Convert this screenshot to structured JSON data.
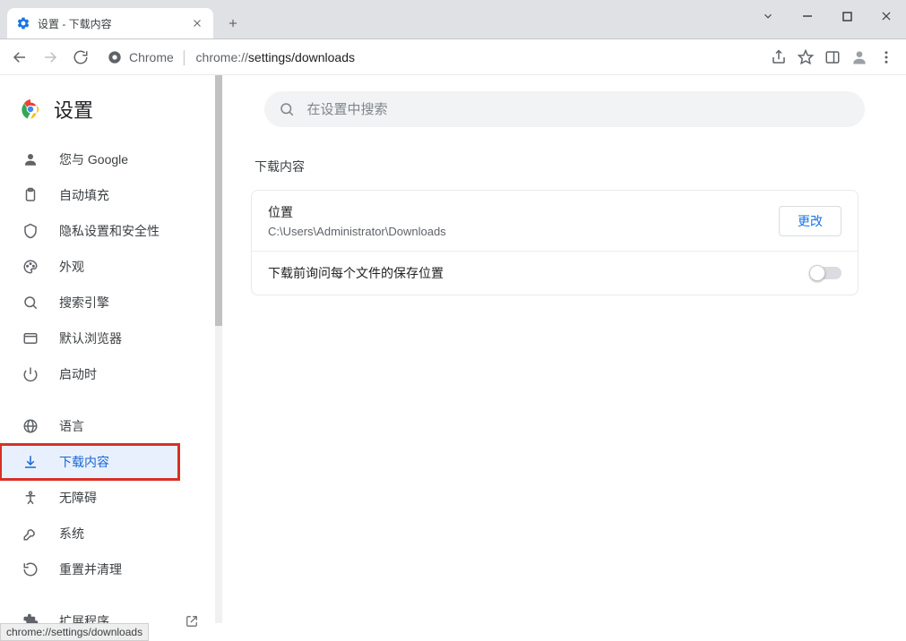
{
  "window": {
    "tab_title": "设置 - 下载内容",
    "new_tab_tooltip": "New tab"
  },
  "toolbar": {
    "secure_label": "Chrome",
    "url_prefix": "chrome://",
    "url_path": "settings/downloads"
  },
  "brand": "设置",
  "search": {
    "placeholder": "在设置中搜索"
  },
  "sidebar": {
    "items": [
      {
        "label": "您与 Google"
      },
      {
        "label": "自动填充"
      },
      {
        "label": "隐私设置和安全性"
      },
      {
        "label": "外观"
      },
      {
        "label": "搜索引擎"
      },
      {
        "label": "默认浏览器"
      },
      {
        "label": "启动时"
      }
    ],
    "group2": [
      {
        "label": "语言"
      },
      {
        "label": "下载内容"
      },
      {
        "label": "无障碍"
      },
      {
        "label": "系统"
      },
      {
        "label": "重置并清理"
      }
    ],
    "group3": [
      {
        "label": "扩展程序"
      }
    ]
  },
  "content": {
    "section_title": "下载内容",
    "location_label": "位置",
    "location_path": "C:\\Users\\Administrator\\Downloads",
    "change_button": "更改",
    "ask_label": "下载前询问每个文件的保存位置"
  },
  "status_bar": "chrome://settings/downloads"
}
